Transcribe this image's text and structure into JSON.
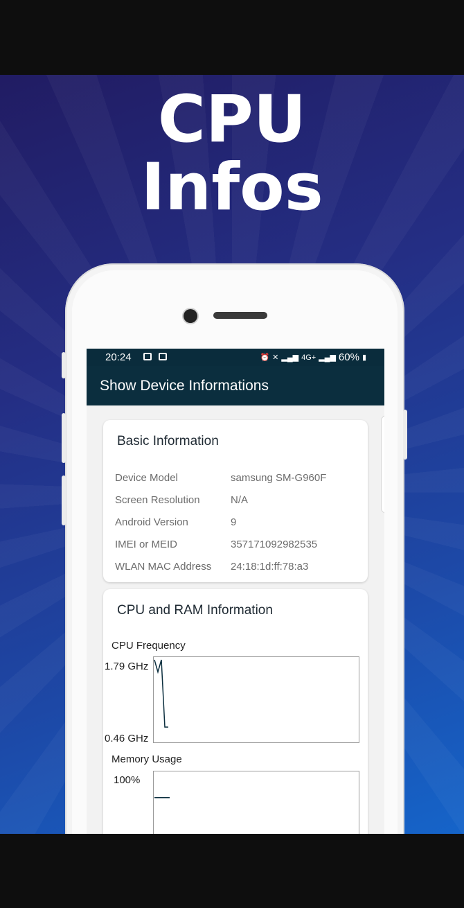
{
  "promo": {
    "headline_line1": "CPU",
    "headline_line2": "Infos"
  },
  "statusbar": {
    "time": "20:24",
    "network": "4G+",
    "battery": "60%"
  },
  "appbar": {
    "title": "Show Device Informations"
  },
  "basic": {
    "title": "Basic Information",
    "rows": [
      {
        "label": "Device Model",
        "value": "samsung SM-G960F"
      },
      {
        "label": "Screen Resolution",
        "value": "N/A"
      },
      {
        "label": "Android Version",
        "value": "9"
      },
      {
        "label": "IMEI or MEID",
        "value": "357171092982535"
      },
      {
        "label": "WLAN MAC Address",
        "value": "24:18:1d:ff:78:a3"
      }
    ]
  },
  "cpu_ram": {
    "title": "CPU and RAM Information",
    "cpu_label": "CPU Frequency",
    "cpu_max": "1.79 GHz",
    "cpu_min": "0.46 GHz",
    "memory_label": "Memory Usage",
    "memory_max": "100%"
  },
  "chart_data": [
    {
      "type": "line",
      "title": "CPU Frequency",
      "ylim": [
        0.46,
        1.79
      ],
      "series": [
        {
          "values": [
            1.79,
            1.55,
            1.79,
            0.46,
            0.46
          ]
        }
      ]
    },
    {
      "type": "line",
      "title": "Memory Usage",
      "ylim": [
        0,
        100
      ],
      "series": [
        {
          "values": [
            76,
            76,
            76
          ]
        }
      ]
    }
  ]
}
